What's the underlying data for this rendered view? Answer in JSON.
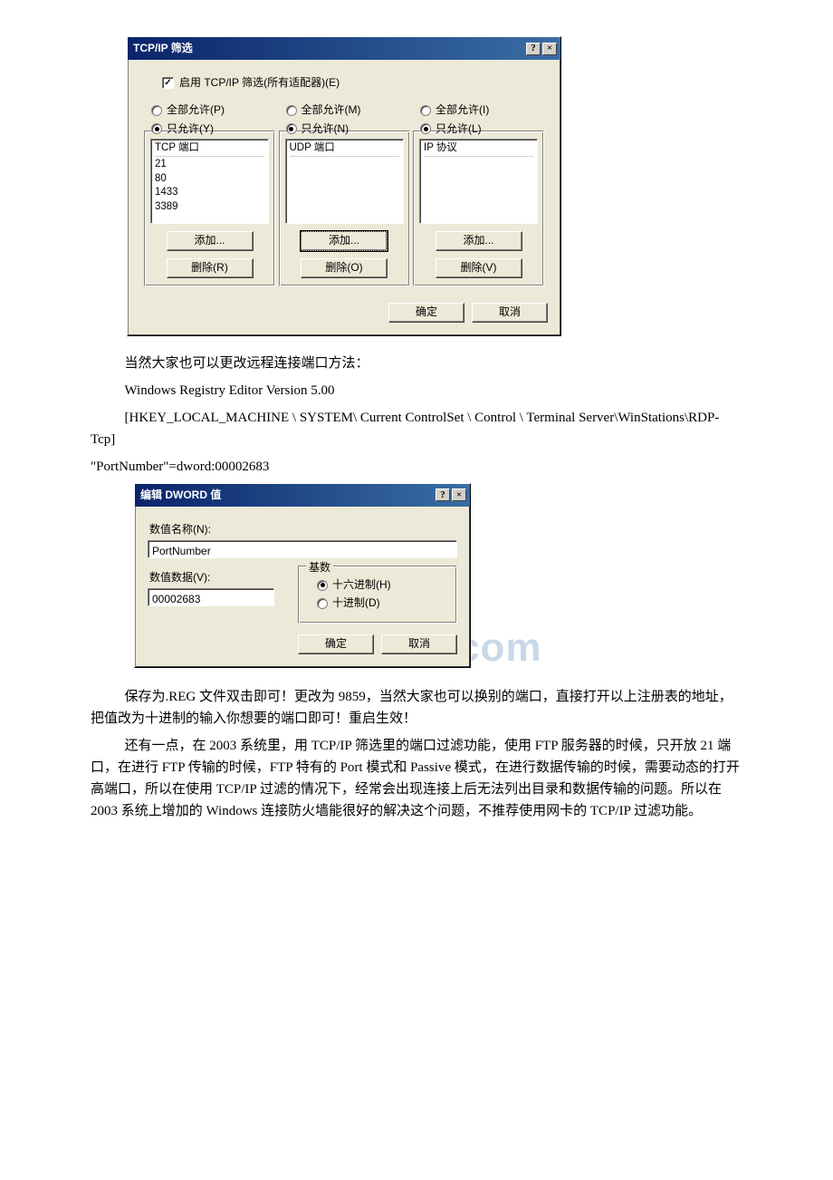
{
  "dialog1": {
    "title": "TCP/IP 筛选",
    "help_btn": "?",
    "close_btn": "×",
    "enable_label": "启用 TCP/IP 筛选(所有适配器)(E)",
    "cols": [
      {
        "allow_all": "全部允许(P)",
        "allow_only": "只允许(Y)",
        "header": "TCP 端口",
        "items": [
          "21",
          "80",
          "1433",
          "3389"
        ],
        "add": "添加...",
        "remove": "删除(R)"
      },
      {
        "allow_all": "全部允许(M)",
        "allow_only": "只允许(N)",
        "header": "UDP 端口",
        "items": [],
        "add": "添加...",
        "remove": "删除(O)"
      },
      {
        "allow_all": "全部允许(I)",
        "allow_only": "只允许(L)",
        "header": "IP 协议",
        "items": [],
        "add": "添加...",
        "remove": "删除(V)"
      }
    ],
    "ok": "确定",
    "cancel": "取消"
  },
  "para1": "当然大家也可以更改远程连接端口方法：",
  "para2": "Windows Registry Editor Version 5.00",
  "para3a": "[HKEY_LOCAL_MACHINE \\ SYSTEM\\ Current ControlSet \\ Control \\ Terminal Server\\WinStations\\RDP-Tcp]",
  "para3b": "\"PortNumber\"=dword:00002683",
  "watermark": "www.bdocx.com",
  "dialog2": {
    "title": "编辑 DWORD 值",
    "help_btn": "?",
    "close_btn": "×",
    "name_label": "数值名称(N):",
    "name_value": "PortNumber",
    "data_label": "数值数据(V):",
    "data_value": "00002683",
    "base_title": "基数",
    "hex": "十六进制(H)",
    "dec": "十进制(D)",
    "ok": "确定",
    "cancel": "取消"
  },
  "para4": "保存为.REG 文件双击即可！更改为 9859，当然大家也可以换别的端口，直接打开以上注册表的地址，把值改为十进制的输入你想要的端口即可！重启生效！",
  "para5": "还有一点，在 2003 系统里，用 TCP/IP 筛选里的端口过滤功能，使用 FTP 服务器的时候，只开放 21 端口，在进行 FTP 传输的时候，FTP 特有的 Port 模式和 Passive 模式，在进行数据传输的时候，需要动态的打开高端口，所以在使用 TCP/IP 过滤的情况下，经常会出现连接上后无法列出目录和数据传输的问题。所以在 2003 系统上增加的 Windows 连接防火墙能很好的解决这个问题，不推荐使用网卡的 TCP/IP 过滤功能。"
}
